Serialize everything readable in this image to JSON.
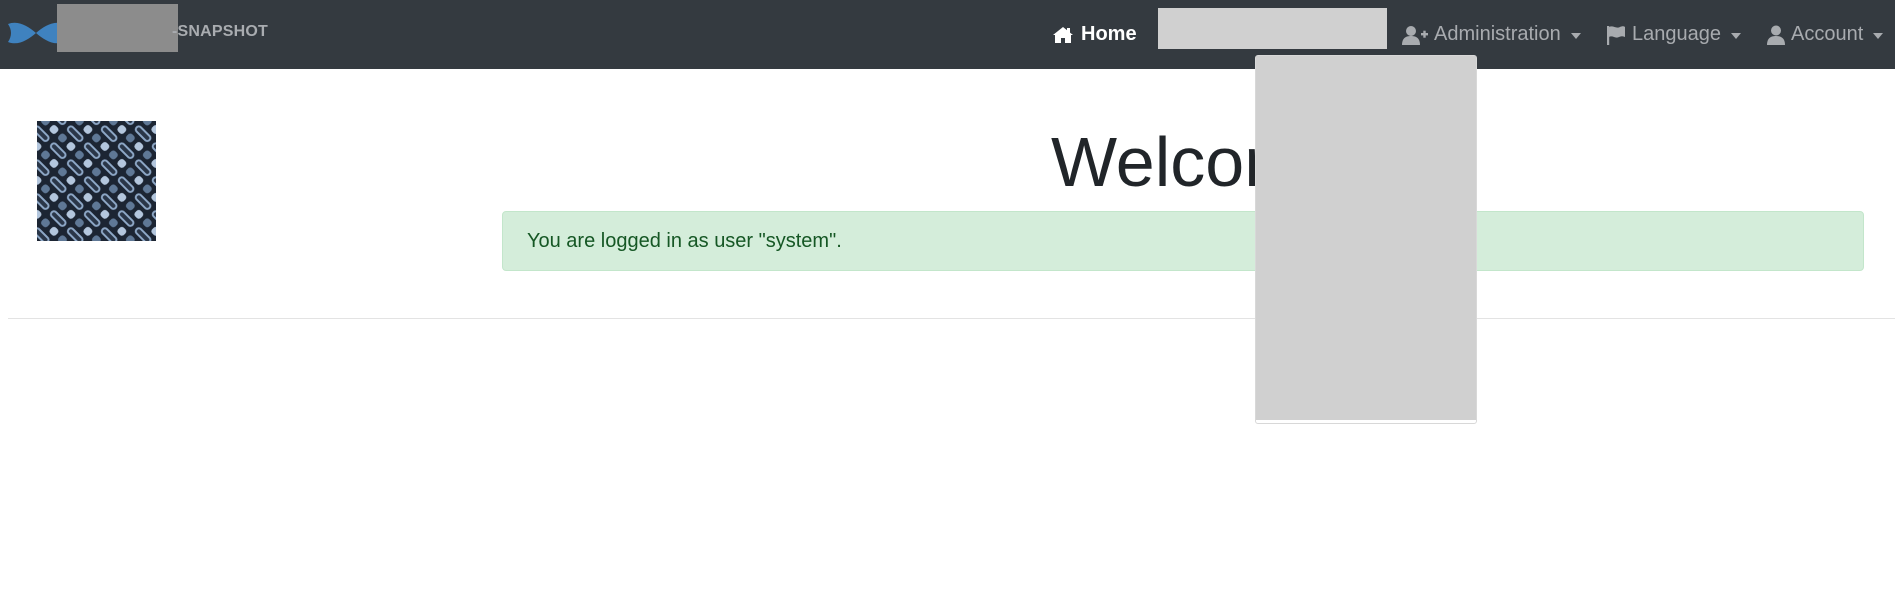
{
  "navbar": {
    "brand_suffix": "-SNAPSHOT",
    "home_label": "Home",
    "administration_label": "Administration",
    "language_label": "Language",
    "account_label": "Account"
  },
  "main": {
    "welcome_text": "Welcom",
    "alert_text": "You are logged in as user \"system\"."
  },
  "colors": {
    "navbar_bg": "#343a40",
    "alert_bg": "#d4edda",
    "alert_text": "#155724",
    "brand_logo": "#3f82bf",
    "redaction": "#d0d0d0"
  },
  "icons": {
    "home": "home-icon",
    "administration": "user-plus-icon",
    "language": "flag-icon",
    "account": "user-icon"
  }
}
